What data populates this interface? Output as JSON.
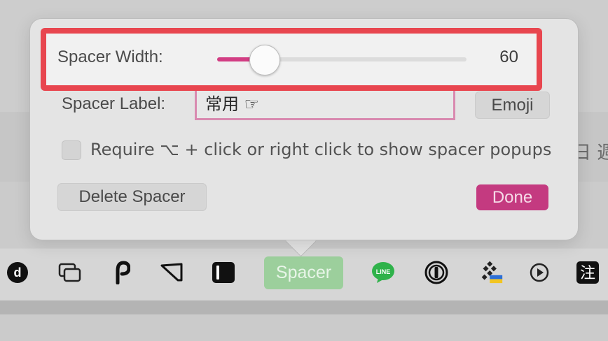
{
  "popover": {
    "spacer_width_label": "Spacer Width:",
    "spacer_width_value": "60",
    "spacer_width_fraction": 0.15,
    "spacer_label_label": "Spacer Label:",
    "spacer_label_value": "常用 ☞",
    "emoji_button": "Emoji",
    "require_checkbox_label": "Require ⌥ + click or right click to show spacer popups",
    "require_checked": false,
    "delete_button": "Delete Spacer",
    "done_button": "Done"
  },
  "menubar": {
    "spacer_label": "Spacer",
    "line_icon_text": "LINE",
    "d_icon_text": "d",
    "chinese_icon_text": "注",
    "icons": [
      "d-icon",
      "windows-icon",
      "p-icon",
      "shape-icon",
      "sidebar-icon",
      "spacer-item",
      "line-icon",
      "1password-icon",
      "grid-flag-icon",
      "play-icon",
      "chinese-icon"
    ]
  },
  "background": {
    "side_text": "日 週"
  },
  "colors": {
    "accent": "#d23d83",
    "highlight": "#e8464f",
    "spacer_green": "#9ccf9c"
  }
}
